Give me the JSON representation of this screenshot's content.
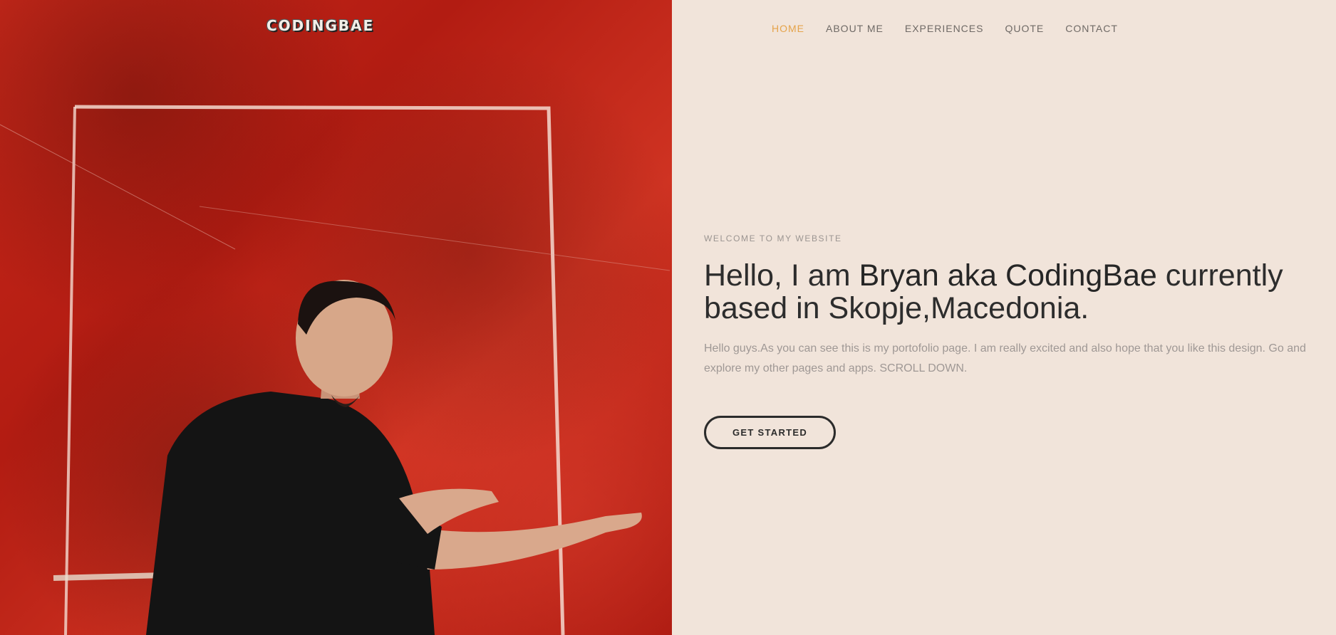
{
  "site": {
    "logo": "CODINGBAE"
  },
  "nav": {
    "items": [
      {
        "label": "HOME",
        "active": true
      },
      {
        "label": "ABOUT ME",
        "active": false
      },
      {
        "label": "EXPERIENCES",
        "active": false
      },
      {
        "label": "QUOTE",
        "active": false
      },
      {
        "label": "CONTACT",
        "active": false
      }
    ]
  },
  "hero": {
    "eyebrow": "WELCOME TO MY WEBSITE",
    "headline_part1": "Hello, I am ",
    "headline_strong": "Bryan aka CodingBae",
    "headline_part2": " currently based in Skopje,Macedonia.",
    "intro": "Hello guys.As you can see this is my portofolio page. I am really excited and also hope that you like this design. Go and explore my other pages and apps. SCROLL DOWN.",
    "cta_label": "GET STARTED"
  },
  "colors": {
    "accent": "#e5a34a",
    "background": "#f1e4da",
    "photo_red": "#c8281a"
  }
}
